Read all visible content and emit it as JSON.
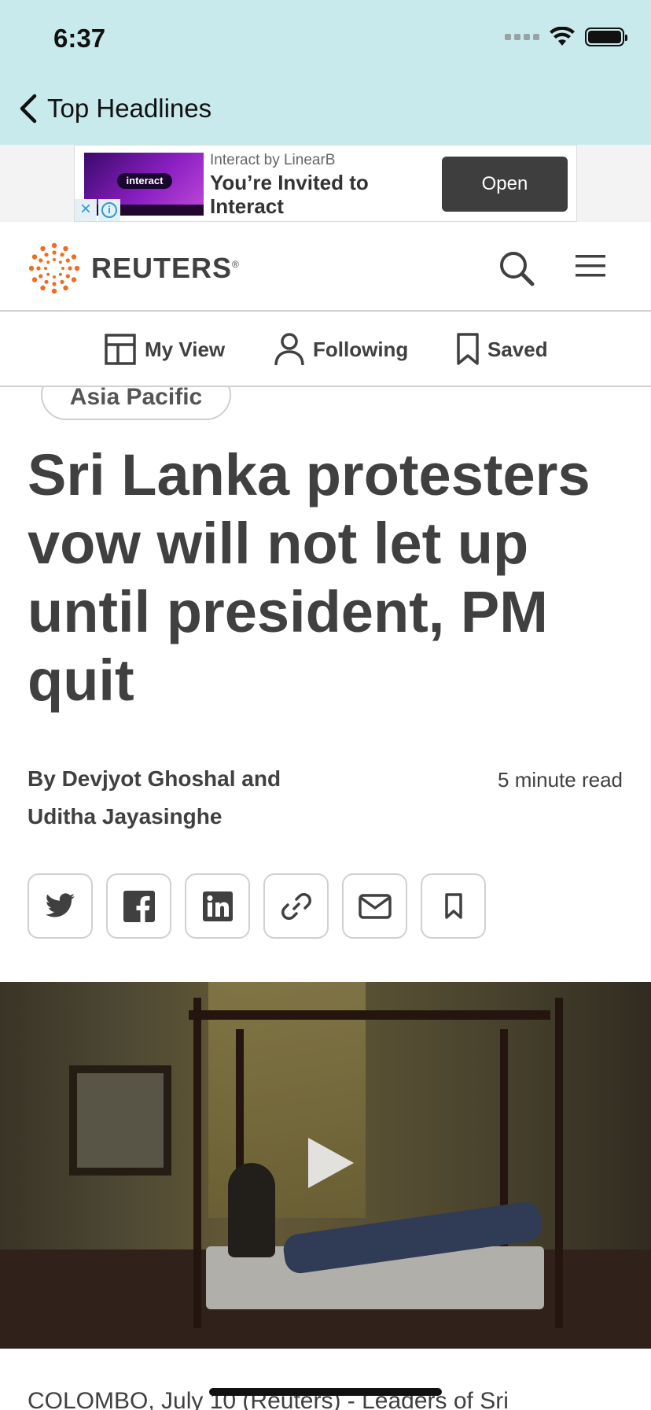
{
  "status_bar": {
    "time": "6:37"
  },
  "nav": {
    "back_label": "Top Headlines"
  },
  "ad": {
    "sponsor": "Interact by LinearB",
    "headline": "You’re Invited to Interact",
    "image_text": "interact",
    "cta": "Open"
  },
  "brand": {
    "name": "REUTERS",
    "registered": "®"
  },
  "subnav": {
    "items": [
      {
        "label": "My View",
        "icon": "layout-icon"
      },
      {
        "label": "Following",
        "icon": "person-icon"
      },
      {
        "label": "Saved",
        "icon": "bookmark-icon"
      }
    ]
  },
  "article": {
    "section": "Asia Pacific",
    "headline": "Sri Lanka protesters vow will not let up until president, PM quit",
    "byline": "By Devjyot Ghoshal and Uditha Jayasinghe",
    "read_time": "5 minute read",
    "share": [
      "twitter-icon",
      "facebook-icon",
      "linkedin-icon",
      "link-icon",
      "mail-icon",
      "bookmark-icon"
    ],
    "lead": "COLOMBO, July 10 (Reuters) - Leaders of Sri"
  },
  "colors": {
    "header_bg": "#c9eaec",
    "reuters_orange": "#f26b21",
    "text": "#404040"
  }
}
